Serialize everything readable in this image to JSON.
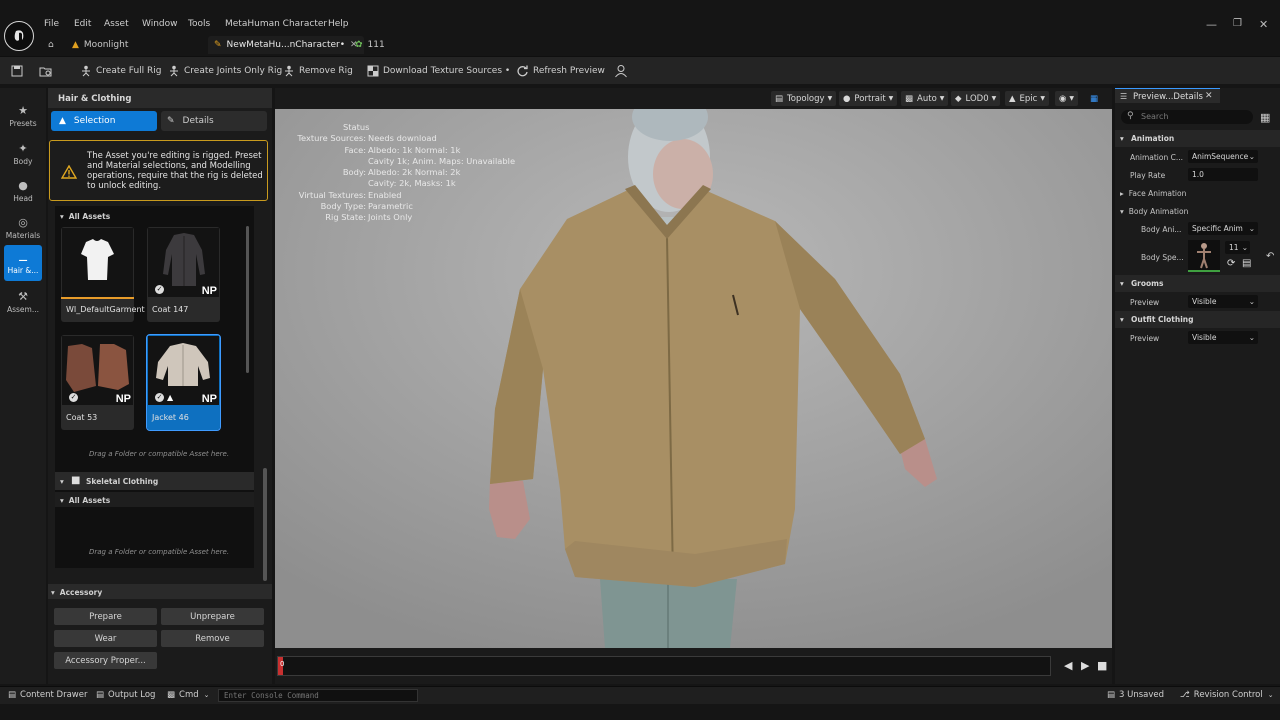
{
  "menu": [
    "File",
    "Edit",
    "Asset",
    "Window",
    "Tools",
    "MetaHuman Character",
    "Help"
  ],
  "tabs": {
    "home": "Moonlight",
    "active": "NewMetaHu...nCharacter•",
    "third": "111"
  },
  "toolbar": {
    "full_rig": "Create Full Rig",
    "joints_rig": "Create Joints Only Rig",
    "remove_rig": "Remove Rig",
    "download": "Download Texture Sources •",
    "refresh": "Refresh Preview"
  },
  "rail": [
    "Presets",
    "Body",
    "Head",
    "Materials",
    "Hair &...",
    "Assem..."
  ],
  "left": {
    "title": "Hair & Clothing",
    "selection": "Selection",
    "details": "Details",
    "warning": "The Asset you're editing is rigged. Preset and Material selections, and Modelling operations, require that the rig is deleted to unlock editing.",
    "all_assets": "All Assets",
    "tiles": [
      {
        "label": "WI_DefaultGarment",
        "badge": ""
      },
      {
        "label": "Coat 147",
        "badge": "NP"
      },
      {
        "label": "Coat 53",
        "badge": "NP"
      },
      {
        "label": "Jacket 46",
        "badge": "NP"
      }
    ],
    "hint": "Drag a Folder or compatible Asset here.",
    "skeletal": "Skeletal Clothing",
    "all_assets2": "All Assets",
    "hint2": "Drag a Folder or compatible Asset here.",
    "accessory": "Accessory",
    "buttons": {
      "prepare": "Prepare",
      "unprepare": "Unprepare",
      "wear": "Wear",
      "remove": "Remove",
      "props": "Accessory Proper..."
    }
  },
  "viewport_bar": {
    "topology": "Topology",
    "portrait": "Portrait",
    "auto": "Auto",
    "lod": "LOD0",
    "epic": "Epic"
  },
  "status": {
    "title": "Status",
    "rows": [
      {
        "k": "Texture Sources:",
        "v": "Needs download"
      },
      {
        "k": "Face:",
        "v": "Albedo: 1k Normal: 1k"
      },
      {
        "k": "",
        "v": "Cavity 1k; Anim. Maps: Unavailable"
      },
      {
        "k": "Body:",
        "v": "Albedo: 2k Normal: 2k"
      },
      {
        "k": "",
        "v": "Cavity: 2k, Masks: 1k"
      },
      {
        "k": "Virtual Textures:",
        "v": "Enabled"
      },
      {
        "k": "Body Type:",
        "v": "Parametric"
      },
      {
        "k": "Rig State:",
        "v": "Joints Only"
      }
    ]
  },
  "timeline": {
    "frame": "0"
  },
  "right": {
    "tab": "Preview...Details",
    "search": "Search",
    "animation": "Animation",
    "anim_class_k": "Animation C...",
    "anim_class_v": "AnimSequence",
    "play_rate_k": "Play Rate",
    "play_rate_v": "1.0",
    "face_anim": "Face Animation",
    "body_anim": "Body Animation",
    "body_ani_k": "Body Ani...",
    "body_ani_v": "Specific Anim",
    "body_spe_k": "Body Spe...",
    "body_spe_v": "11",
    "grooms": "Grooms",
    "grooms_preview_k": "Preview",
    "grooms_preview_v": "Visible",
    "outfit": "Outfit Clothing",
    "outfit_preview_k": "Preview",
    "outfit_preview_v": "Visible"
  },
  "statusbar": {
    "drawer": "Content Drawer",
    "output": "Output Log",
    "cmd": "Cmd",
    "console_placeholder": "Enter Console Command",
    "unsaved": "3 Unsaved",
    "revision": "Revision Control"
  }
}
